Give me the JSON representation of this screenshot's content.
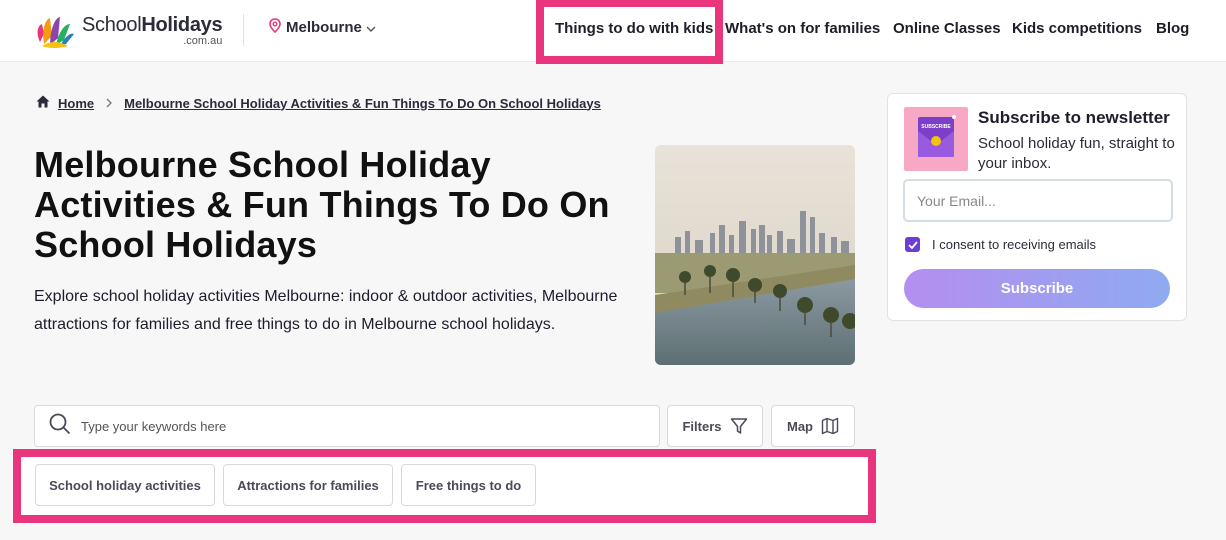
{
  "header": {
    "logo_text_light": "School",
    "logo_text_bold": "Holidays",
    "logo_sub": ".com.au",
    "location": "Melbourne",
    "nav": [
      {
        "label": "Things to do with kids"
      },
      {
        "label": "What's on for families"
      },
      {
        "label": "Online Classes"
      },
      {
        "label": "Kids competitions"
      },
      {
        "label": "Blog"
      }
    ]
  },
  "breadcrumb": {
    "home": "Home",
    "current": "Melbourne School Holiday Activities & Fun Things To Do On School Holidays"
  },
  "main": {
    "title": "Melbourne School Holiday Activities & Fun Things To Do On School Holidays",
    "intro": "Explore school holiday activities Melbourne: indoor & outdoor activities, Melbourne attractions for families and free things to do in Melbourne school holidays."
  },
  "search": {
    "placeholder": "Type your keywords here",
    "filters_label": "Filters",
    "map_label": "Map"
  },
  "chips": [
    {
      "label": "School holiday activities"
    },
    {
      "label": "Attractions for families"
    },
    {
      "label": "Free things to do"
    }
  ],
  "newsletter": {
    "title": "Subscribe to newsletter",
    "subtitle": "School holiday fun, straight to your inbox.",
    "email_placeholder": "Your Email...",
    "consent_label": "I consent to receiving emails",
    "consent_checked": true,
    "button_label": "Subscribe",
    "badge_text": "SUBSCRIBE"
  },
  "colors": {
    "highlight": "#e8357c",
    "accent_purple": "#6b3fd4"
  }
}
